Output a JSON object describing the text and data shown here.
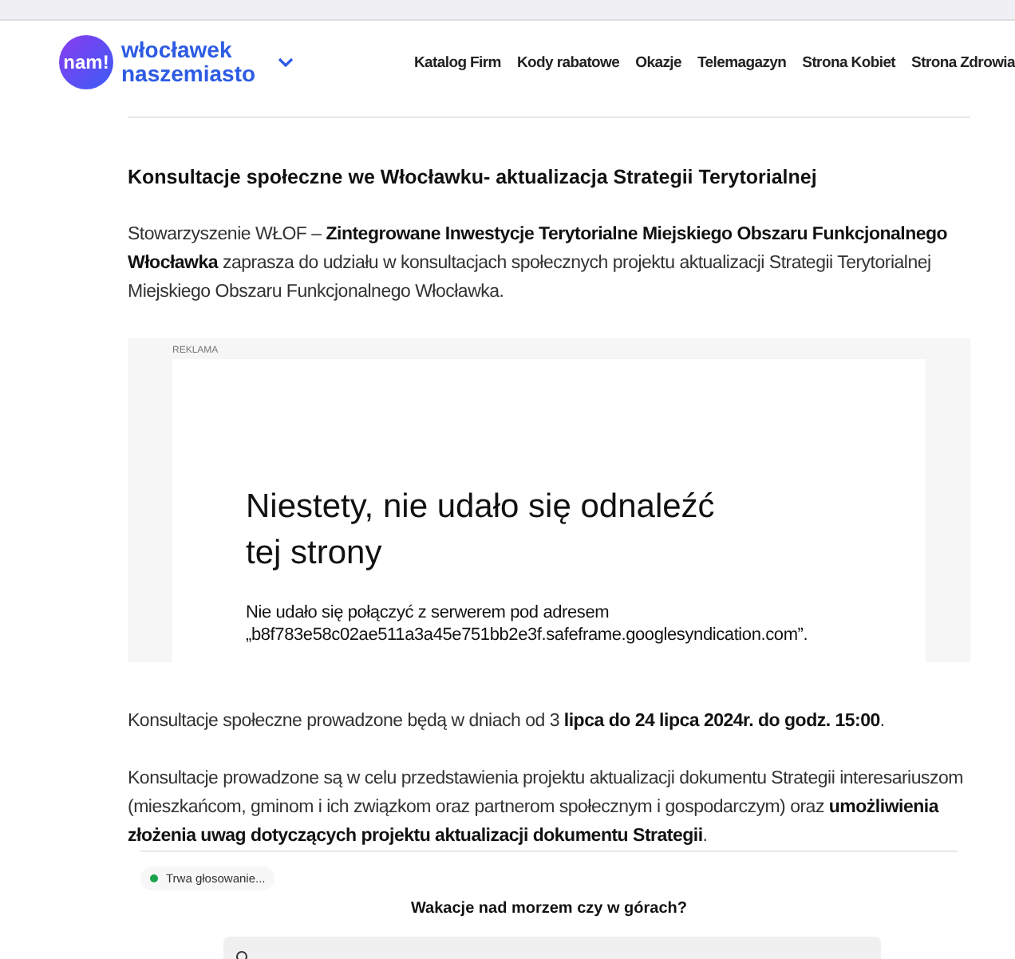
{
  "header": {
    "logo_badge": "nam!",
    "logo_line_1": "włocławek",
    "logo_line_2": "naszemiasto",
    "nav": [
      {
        "label": "Katalog Firm"
      },
      {
        "label": "Kody rabatowe"
      },
      {
        "label": "Okazje"
      },
      {
        "label": "Telemagazyn"
      },
      {
        "label": "Strona Kobiet"
      },
      {
        "label": "Strona Zdrowia"
      }
    ]
  },
  "article": {
    "title": "Konsultacje społeczne we Włocławku- aktualizacja Strategii Terytorialnej",
    "lead": "Stowarzyszenie WŁOF – **Zintegrowane Inwestycje Terytorialne Miejskiego Obszaru Funkcjonalnego Włocławka** zaprasza do udziału w konsultacjach społecznych projektu aktualizacji Strategii Terytorialnej Miejskiego Obszaru Funkcjonalnego Włocławka.",
    "ad": {
      "label": "REKLAMA",
      "error_title": "Niestety, nie udało się odnaleźć tej strony",
      "error_text": "Nie udało się połączyć z serwerem pod adresem „b8f783e58c02ae511a3a45e751bb2e3f.safeframe.googlesyndication.com”."
    },
    "paragraphs": [
      "Konsultacje społeczne prowadzone będą w dniach od 3 **lipca do 24 lipca 2024r. do godz. 15:00**.",
      "Konsultacje prowadzone są w celu przedstawienia projektu aktualizacji dokumentu Strategii interesariuszom (mieszkańcom, gminom i ich związkom oraz partnerom społecznym i gospodarczym) oraz **umożliwienia złożenia uwag dotyczących projektu aktualizacji dokumentu Strategii**."
    ]
  },
  "poll": {
    "status": "Trwa głosowanie...",
    "question": "Wakacje nad morzem czy w górach?"
  }
}
